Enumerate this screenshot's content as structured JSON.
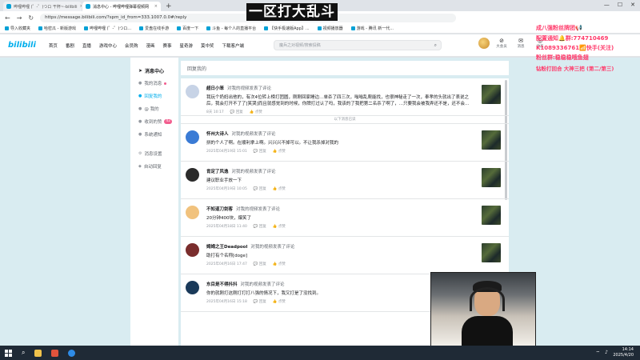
{
  "browser": {
    "tabs": [
      {
        "label": "哔哩哔哩 (゜-゜)つロ 干杯~-bilibili",
        "active": false
      },
      {
        "label": "消息中心 - 哔哩哔哩弹幕视频网",
        "active": true
      }
    ],
    "url": "https://message.bilibili.com/?spm_id_from=333.1007.0.0#/reply",
    "bookmarks": [
      "导入收藏夹",
      "哈密瓜 - 新版游戏",
      "哔哩哔哩 (゜-゜)つロ...",
      "爱盘在线手游",
      "百度一下",
      "斗鱼 - 每个人的直播平台",
      "【快手极速版App】...",
      "视频播放器",
      "游戏 - 腾讯 新一代..."
    ]
  },
  "overlay": {
    "title": "一区打大乱斗",
    "line1": "成八强粉丝牌团📢",
    "line2": "配置通知🔔群:774710469",
    "line3": "K1089336761📶快手(关注)",
    "line4": "粉丝群:稳稳稳哦鱼翅",
    "line5": "钻粉打回合 大神三把 (第二/第三)"
  },
  "header": {
    "logo": "bilibili",
    "nav": [
      "首页",
      "番剧",
      "直播",
      "游戏中心",
      "会员购",
      "漫画",
      "赛事",
      "星奇游",
      "莫中奖",
      "下载客户端"
    ],
    "search_placeholder": "魔兵之对视频/搜索投稿",
    "right": [
      {
        "icon": "avatar",
        "label": ""
      },
      {
        "icon": "vip-icon",
        "label": "大会员"
      },
      {
        "icon": "message-icon",
        "label": "消息",
        "badge": "42"
      },
      {
        "icon": "dynamic-icon",
        "label": "动态"
      }
    ]
  },
  "sidebar": {
    "title": "消息中心",
    "items": [
      {
        "label": "我的消息",
        "active": false,
        "dot": true
      },
      {
        "label": "回复我的",
        "active": true
      },
      {
        "label": "@ 我的",
        "active": false
      },
      {
        "label": "收到的赞",
        "active": false,
        "badge": "42"
      },
      {
        "label": "系统通知",
        "active": false
      },
      {
        "label": "消息设置",
        "active": false
      },
      {
        "label": "自动回复",
        "active": false
      }
    ]
  },
  "content": {
    "header": "回复我的",
    "read_divider": "以下消息已读",
    "messages": [
      {
        "user": "超日小笨",
        "action": "对我的视频发表了评论",
        "text": "我玩个奶妈出他的，有次4位转上榜打团圆，刚刚回家睡边…单杀了四三次，嗡嗡乱爬能找，也很神秘走了一次，奉孝的头就出了表说之后，我会打开不了了[笑哭]而且就感觉到的时候，你牌打过认了吗，我该的了我把第二名杀了啊了，...只要我会被我弄还不是，还不会…",
        "time": "8天 10:17",
        "reply": "回复",
        "like": "点赞",
        "avatar": "#c7d3e6"
      },
      {
        "user": "怀州大诗人",
        "action": "对我的视频发表了评论",
        "text": "拼的个人了啊。在顺利拿上啊。兴兴兴不掉可以。不让我杀掉对我的",
        "time": "2025年04月19日 15:01",
        "reply": "回复",
        "like": "点赞",
        "avatar": "#3a7bd5"
      },
      {
        "user": "肯定了风逸",
        "action": "对我的视频发表了评论",
        "text": "建议职业手放一下",
        "time": "2025年04月19日 10:05",
        "reply": "回复",
        "like": "点赞",
        "avatar": "#2b2b2b"
      },
      {
        "user": "不知道刀剑客",
        "action": "对我的视频发表了评论",
        "text": "20分钟400块，爆笑了",
        "time": "2025年04月18日 11:40",
        "reply": "回复",
        "like": "点赞",
        "avatar": "#f1c27d"
      },
      {
        "user": "姆姆之王Deadpool",
        "action": "对我的视频发表了评论",
        "text": "助打有个名称[doge]",
        "time": "2025年04月16日 17:47",
        "reply": "回复",
        "like": "点赞",
        "avatar": "#7a2d2d"
      },
      {
        "user": "东目是不得抖抖",
        "action": "对我的视频发表了评论",
        "text": "你的就刚打这刚打打打八强的情况下，我又打是了没找到。",
        "time": "2025年04月16日 15:18",
        "reply": "回复",
        "like": "点赞",
        "avatar": "#1a3a5a"
      }
    ]
  },
  "taskbar": {
    "time": "14:14",
    "date": "2025/4/20"
  }
}
